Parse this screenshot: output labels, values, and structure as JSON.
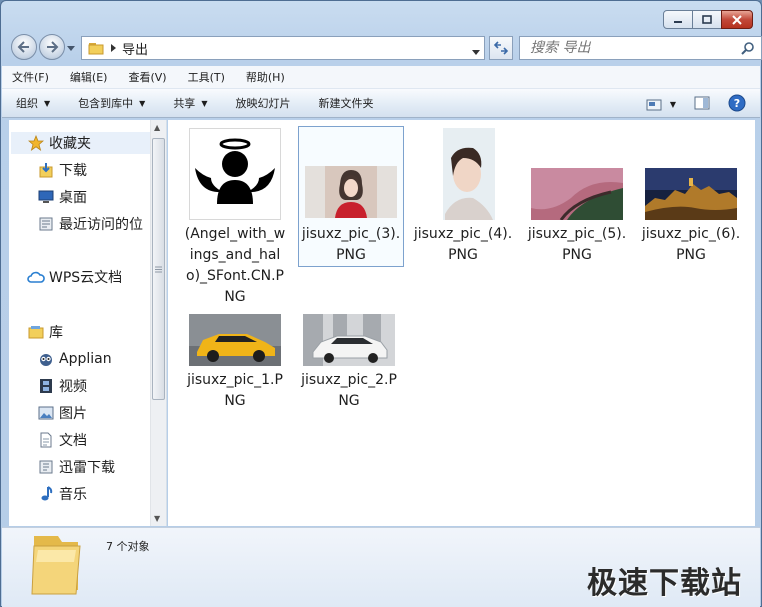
{
  "window": {
    "breadcrumb": "导出",
    "search_placeholder": "搜索 导出"
  },
  "menubar": {
    "items": [
      "文件(F)",
      "编辑(E)",
      "查看(V)",
      "工具(T)",
      "帮助(H)"
    ]
  },
  "toolbar": {
    "organize": "组织",
    "include_library": "包含到库中",
    "share": "共享",
    "slideshow": "放映幻灯片",
    "new_folder": "新建文件夹"
  },
  "sidebar": {
    "favorites": "收藏夹",
    "downloads": "下载",
    "desktop": "桌面",
    "recent": "最近访问的位",
    "wps": "WPS云文档",
    "library": "库",
    "applian": "Applian",
    "videos": "视频",
    "pictures": "图片",
    "documents": "文档",
    "xunlei": "迅雷下载",
    "music": "音乐"
  },
  "files": [
    {
      "name": "(Angel_with_wings_and_halo)_SFont.CN.PNG"
    },
    {
      "name": "jisuxz_pic_(3).PNG"
    },
    {
      "name": "jisuxz_pic_(4).PNG"
    },
    {
      "name": "jisuxz_pic_(5).PNG"
    },
    {
      "name": "jisuxz_pic_(6).PNG"
    },
    {
      "name": "jisuxz_pic_1.PNG"
    },
    {
      "name": "jisuxz_pic_2.PNG"
    }
  ],
  "status": {
    "count": "7 个对象"
  },
  "watermark": "极速下载站"
}
